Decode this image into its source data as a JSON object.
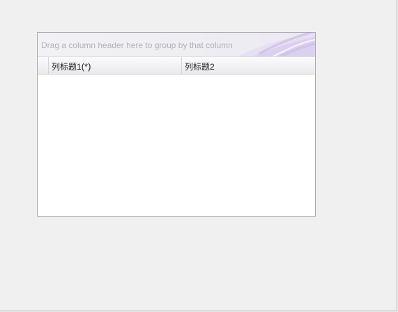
{
  "grid": {
    "group_panel_hint": "Drag a column header here to group by that column",
    "columns": [
      {
        "label": "列标题1",
        "required_mark": "(*)"
      },
      {
        "label": "列标题2"
      }
    ],
    "rows": []
  },
  "colors": {
    "background": "#f0f0f0",
    "grid_border": "#a9a9b4",
    "hint_text": "#b2b2bb",
    "accent_swoosh": "#c9b8e6"
  }
}
